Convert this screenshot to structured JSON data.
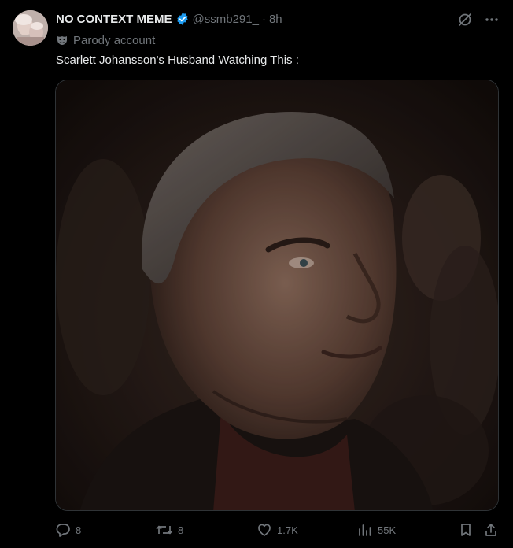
{
  "post": {
    "display_name": "NO CONTEXT MEME",
    "handle": "@ssmb291_",
    "separator": "·",
    "time": "8h",
    "parody_label": "Parody account",
    "text": "Scarlett Johansson's Husband Watching This :",
    "media_icon": "photo-of-man-in-cinema",
    "verified_color": "#1d9bf0"
  },
  "metrics": {
    "replies": "8",
    "reposts": "8",
    "likes": "1.7K",
    "views": "55K"
  },
  "icons": {
    "grok": "grok-icon",
    "more": "more-icon",
    "reply": "reply-icon",
    "repost": "repost-icon",
    "like": "heart-icon",
    "views": "views-icon",
    "bookmark": "bookmark-icon",
    "share": "share-icon"
  }
}
